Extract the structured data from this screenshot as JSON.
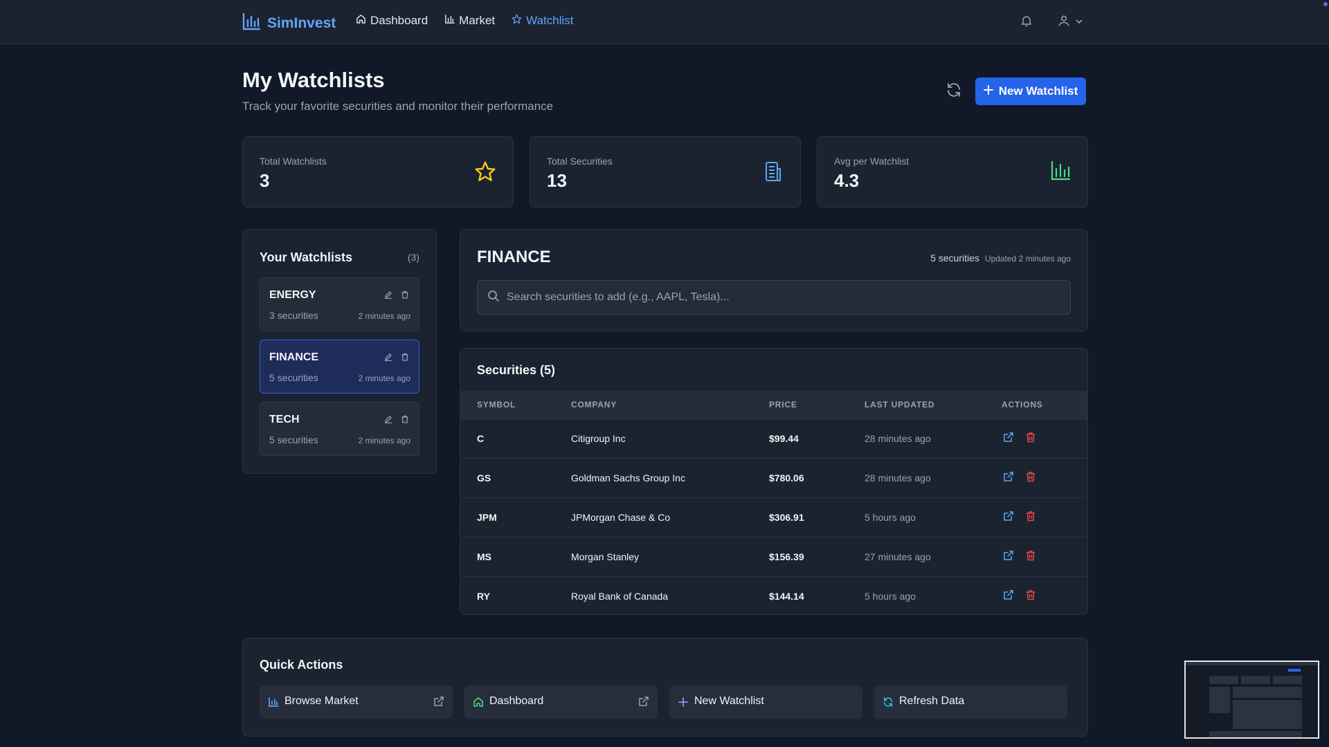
{
  "nav": {
    "brand": "SimInvest",
    "links": [
      {
        "label": "Dashboard",
        "icon": "home-icon"
      },
      {
        "label": "Market",
        "icon": "bar-chart-icon"
      },
      {
        "label": "Watchlist",
        "icon": "star-icon"
      }
    ],
    "active_link": "Watchlist"
  },
  "header": {
    "title": "My Watchlists",
    "subtitle": "Track your favorite securities and monitor their performance",
    "new_button": "New Watchlist"
  },
  "stats": [
    {
      "label": "Total Watchlists",
      "value": "3",
      "icon": "star-icon"
    },
    {
      "label": "Total Securities",
      "value": "13",
      "icon": "building-icon"
    },
    {
      "label": "Avg per Watchlist",
      "value": "4.3",
      "icon": "bar-chart-icon"
    }
  ],
  "watchlists": {
    "title": "Your Watchlists",
    "count": "(3)",
    "items": [
      {
        "name": "ENERGY",
        "securities": "3 securities",
        "updated": "2 minutes ago"
      },
      {
        "name": "FINANCE",
        "securities": "5 securities",
        "updated": "2 minutes ago"
      },
      {
        "name": "TECH",
        "securities": "5 securities",
        "updated": "2 minutes ago"
      }
    ],
    "active": "FINANCE"
  },
  "detail": {
    "name": "FINANCE",
    "count": "5 securities",
    "updated": "Updated 2 minutes ago",
    "search_placeholder": "Search securities to add (e.g., AAPL, Tesla)..."
  },
  "table": {
    "title": "Securities (5)",
    "columns": [
      "SYMBOL",
      "COMPANY",
      "PRICE",
      "LAST UPDATED",
      "ACTIONS"
    ],
    "rows": [
      {
        "symbol": "C",
        "company": "Citigroup Inc",
        "price": "$99.44",
        "updated": "28 minutes ago"
      },
      {
        "symbol": "GS",
        "company": "Goldman Sachs Group Inc",
        "price": "$780.06",
        "updated": "28 minutes ago"
      },
      {
        "symbol": "JPM",
        "company": "JPMorgan Chase & Co",
        "price": "$306.91",
        "updated": "5 hours ago"
      },
      {
        "symbol": "MS",
        "company": "Morgan Stanley",
        "price": "$156.39",
        "updated": "27 minutes ago"
      },
      {
        "symbol": "RY",
        "company": "Royal Bank of Canada",
        "price": "$144.14",
        "updated": "5 hours ago"
      }
    ]
  },
  "quick_actions": {
    "title": "Quick Actions",
    "buttons": [
      {
        "label": "Browse Market",
        "icon": "bar-chart-icon"
      },
      {
        "label": "Dashboard",
        "icon": "home-icon"
      },
      {
        "label": "New Watchlist",
        "icon": "plus-icon"
      },
      {
        "label": "Refresh Data",
        "icon": "refresh-icon"
      }
    ]
  },
  "colors": {
    "background": "#111827",
    "surface": "#1b2330",
    "accent": "#2563eb",
    "link_active": "#60a5fa",
    "star": "#facc15",
    "positive": "#4ade80",
    "danger": "#ef4444"
  }
}
